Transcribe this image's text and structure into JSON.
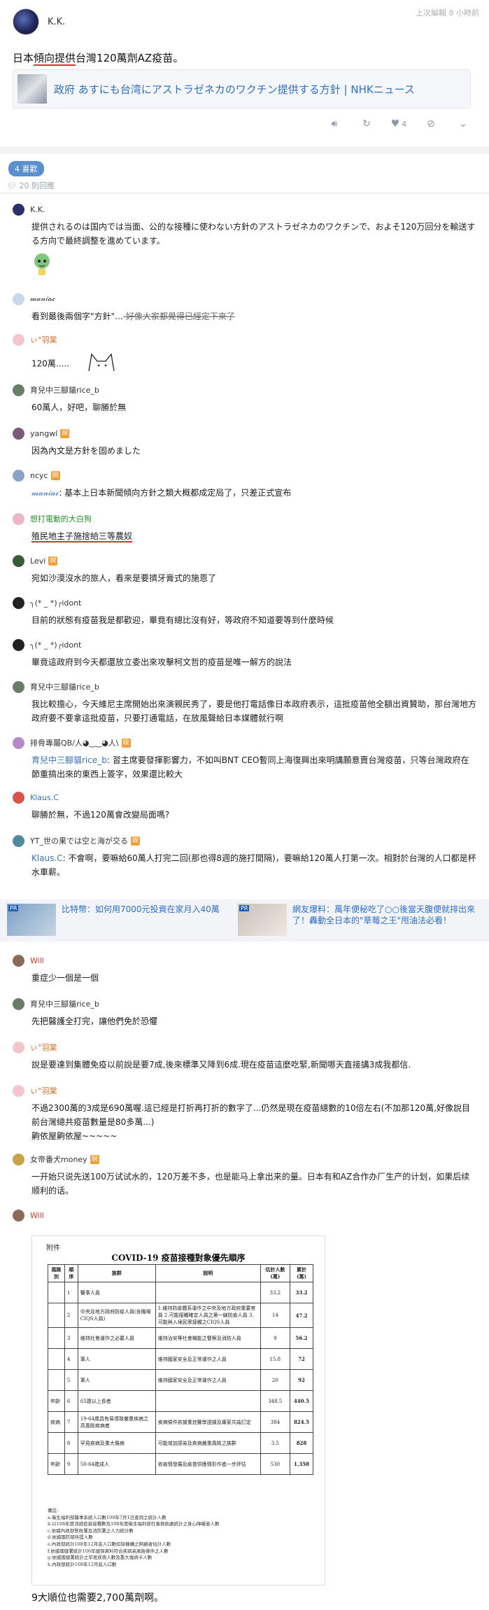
{
  "post": {
    "author": "K.K.",
    "edited": "上次編輯 8 小時前",
    "body_pre": "日本",
    "body_ul": "傾向提供",
    "body_post": "台灣120萬劑AZ疫苗。",
    "link_title": "政府 あすにも台湾にアストラゼネカのワクチン提供する方針 | NHKニュース",
    "like_count": "4"
  },
  "stats": {
    "likes": "4 喜歡",
    "replies": "20 則回應"
  },
  "colors": {
    "accent": "#5a8fd0",
    "link": "#2d6fc7",
    "underline": "#d33333"
  },
  "comments": [
    {
      "name": "K.K.",
      "text": "提供されるのは国内では当面、公的な接種に使わない方針のアストラゼネカのワクチンで、およそ120万回分を輸送する方向で最終調整を進めています。"
    },
    {
      "name": "𝓂𝒶𝓃𝒾𝒶𝒸",
      "text_pre": "看到最後兩個字\"方針\"…",
      "text_strike": " 好像大家都覺得已經定下來了"
    },
    {
      "name": "ぃ°羽棠",
      "text": "120萬....."
    },
    {
      "name": "育兒中三腳貓rice_b",
      "text": "60萬人，好吧，聊勝於無"
    },
    {
      "name": "yangwl",
      "tag": "說",
      "text": "因為內文是方針を固めました"
    },
    {
      "name": "ncyc",
      "tag": "說",
      "mention": "𝓂𝒶𝓃𝒾𝒶𝒸",
      "text": ": 基本上日本新聞傾向方針之類大概都成定局了，只差正式宣布"
    },
    {
      "name": "想打電動的大白狗",
      "text": "殖民地主子施捨給三等農奴"
    },
    {
      "name": "Levi",
      "tag": "說",
      "text": "宛如沙漠沒水的旅人，看來是要擠牙膏式的施恩了"
    },
    {
      "name": "╮(* _ *)╭idont",
      "text": "目前的狀態有疫苗我是都歡迎，畢竟有總比沒有好，等政府不知道要等到什麼時候"
    },
    {
      "name": "╮(* _ *)╭idont",
      "text": "畢竟這政府到今天都還放立委出來攻擊柯文哲的疫苗是唯一解方的說法"
    },
    {
      "name": "育兒中三腳貓rice_b",
      "text": "我比較擔心，今天維尼主席開始出來演親民秀了，要是他打電話像日本政府表示，這批疫苗他全額出資贊助，那台灣地方政府要不要拿這批疫苗，只要打通電話，在放風聲給日本媒體就行啊"
    },
    {
      "name": "排骨專屬QB/人◕‿‿◕人\\",
      "tag": "說",
      "mention": "育兒中三腳貓rice_b",
      "text": ": 習主席要發揮影響力，不如叫BNT CEO暫同上海復興出來明講願意賣台灣疫苗，只等台灣政府在節重搞出來的東西上簽字，效果還比較大"
    },
    {
      "name": "Klaus.C",
      "text": "聊勝於無，不過120萬會改變局面嗎?"
    },
    {
      "name": "YT_世の果では空と海が交る",
      "tag": "說",
      "mention": "Klaus.C",
      "text": ": 不會啊，要嘛給60萬人打完二回(那也得8週的施打間隔)，要嘛給120萬人打第一次。相對於台灣的人口都是杯水車薪。"
    },
    {
      "name": "Will",
      "text": "重症少一個是一個"
    },
    {
      "name": "育兒中三腳貓rice_b",
      "text": "先把醫護全打完，讓他們免於恐懼"
    },
    {
      "name": "ぃ°羽棠",
      "text": "說是要達到集體免疫以前說是要7成,後來標準又降到6成.現在疫苗這麼吃緊,新聞哪天直接講3成我都信."
    },
    {
      "name": "ぃ°羽棠",
      "text": "不過2300萬的3成是690萬喔.這已經是打折再打折的數字了...仍然是現在疫苗總數的10倍左右(不加那120萬,好像說目前台灣總共疫苗數量是80多萬...)",
      "text2": "齁依屋齁依屋~~~~~"
    },
    {
      "name": "女帝番犬money",
      "tag": "說",
      "text": "一开始只说先送100万试试水的，120万差不多，也是能马上拿出来的量。日本有和AZ合作办厂生产的计划，如果后续顺利的话。"
    },
    {
      "name": "Will",
      "final": "9大順位也需要2,700萬劑啊。"
    }
  ],
  "ads": [
    {
      "text": "比特幣：如何用7000元投資在家月入40萬"
    },
    {
      "text": "網友爆料：萬年便秘吃了○○後當天腹便就排出來了！轟動全日本的\"草莓之王\"甩油法必看！"
    }
  ],
  "table": {
    "caption": "附件",
    "title": "COVID-19 疫苗接種對象優先順序",
    "headers": [
      "風險別",
      "順序",
      "族群",
      "說明",
      "估計人數(萬)",
      "累計(萬)"
    ],
    "rows": [
      [
        "",
        "1",
        "醫事人員",
        "",
        "33.2",
        "33.2"
      ],
      [
        "",
        "2",
        "中央及地方政府防疫人員(含機場CIQS人員)",
        "1.維持防疫體系運作之中央及地方政府重要官員 2.可能接觸確定人員之第一線防疫人員 3.可能與入境民眾接觸之CIQS人員",
        "14",
        "47.2"
      ],
      [
        "",
        "3",
        "維持社會運作之必要人員",
        "維持治安等社會機能之警察及消防人員",
        "9",
        "56.2"
      ],
      [
        "",
        "4",
        "軍人",
        "維持國家安全及正常運作之人員",
        "15.8",
        "72"
      ],
      [
        "",
        "5",
        "軍人",
        "維持國家安全及正常運作之人員",
        "20",
        "92"
      ],
      [
        "年齡",
        "6",
        "65歲以上長者",
        "",
        "348.5",
        "440.5"
      ],
      [
        "疾病",
        "7",
        "19-64歲具有易導致嚴重疾病之高風險疾病者",
        "疾病條件依據重症醫學證據及專家共識訂定",
        "384",
        "824.5"
      ],
      [
        "",
        "8",
        "罕見疾病及重大傷病",
        "可能增加感染及疾病嚴重風險之族群",
        "3.5",
        "828"
      ],
      [
        "年齡",
        "9",
        "50-64歲成人",
        "依疫情發展及疫苗供應情形作進一步評估",
        "530",
        "1,358"
      ]
    ],
    "notes": [
      "備註:",
      "a.衛生福利部醫事系統人口數109年7月1日查詢之統計人數",
      "b.以108年度流感疫苗接種數及108年度衛生福利部社會救助處統計之身心障礙者人數",
      "c.依據內政部警政署及消防署之人力統計數",
      "d.依據國防部所提人數",
      "e.內政部統計108年12月底人口數扣除機構之照顧者估計人數",
      "f.依據國健署統計106年健保資料符合疾病高風險條件之人數",
      "g.依據國健署統計之罕見疾病人數及重大傷病卡人數",
      "h.內政部統計108年12月底人口數"
    ]
  }
}
